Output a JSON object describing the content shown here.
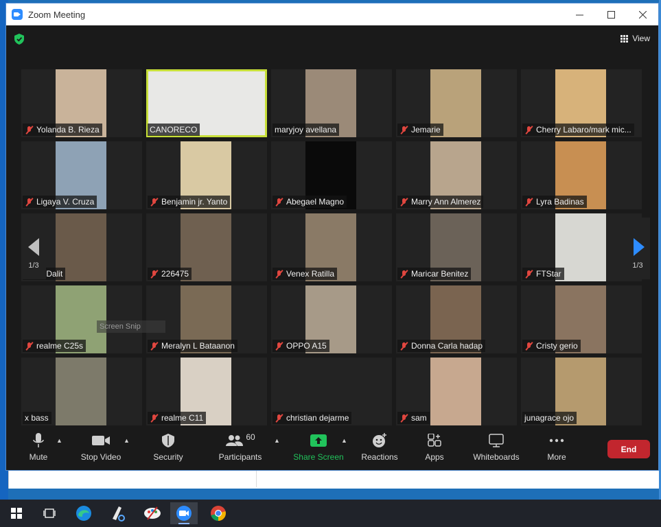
{
  "window": {
    "title": "Zoom Meeting"
  },
  "view": {
    "label": "View"
  },
  "participants": [
    {
      "name": "Yolanda B. Rieza",
      "muted": true,
      "video_color": "#c9b39a"
    },
    {
      "name": "CANORECO",
      "muted": false,
      "active_speaker": true,
      "video_color": "#e8e8e6"
    },
    {
      "name": "maryjoy avellana",
      "muted": false,
      "video_color": "#9b8a78"
    },
    {
      "name": "Jemarie",
      "muted": true,
      "video_color": "#b9a27a"
    },
    {
      "name": "Cherry Labaro/mark mic...",
      "muted": true,
      "video_color": "#d7b27a"
    },
    {
      "name": "Ligaya V. Cruza",
      "muted": true,
      "video_color": "#8ea2b5"
    },
    {
      "name": "Benjamin jr. Yanto",
      "muted": true,
      "video_color": "#d9c9a3"
    },
    {
      "name": "Abegael Magno",
      "muted": true,
      "video_color": "#0a0a0a"
    },
    {
      "name": "Marry Ann Almerez",
      "muted": true,
      "video_color": "#b8a58d"
    },
    {
      "name": "Lyra Badinas",
      "muted": true,
      "video_color": "#c88f52"
    },
    {
      "name": "an S. Dalit",
      "muted": false,
      "video_color": "#6a5a4a"
    },
    {
      "name": "226475",
      "muted": true,
      "video_color": "#6f6050"
    },
    {
      "name": "Venex Ratilla",
      "muted": true,
      "video_color": "#8a7a66"
    },
    {
      "name": "Maricar Benitez",
      "muted": true,
      "video_color": "#6b6258"
    },
    {
      "name": "FTStar",
      "muted": true,
      "video_color": "#d7d7d2"
    },
    {
      "name": "realme C25s",
      "muted": true,
      "video_color": "#8fa274"
    },
    {
      "name": "Meralyn L Bataanon",
      "muted": true,
      "video_color": "#7a6a55"
    },
    {
      "name": "OPPO A15",
      "muted": true,
      "video_color": "#a79a88"
    },
    {
      "name": "Donna Carla hadap",
      "muted": true,
      "video_color": "#7a6450"
    },
    {
      "name": "Cristy gerio",
      "muted": true,
      "video_color": "#8a7460"
    },
    {
      "name": "x bass",
      "muted": false,
      "video_color": "#7d7a6a"
    },
    {
      "name": "realme C11",
      "muted": true,
      "video_color": "#d9d0c4"
    },
    {
      "name": "christian dejarme",
      "muted": true,
      "video_color": null
    },
    {
      "name": "sam",
      "muted": true,
      "video_color": "#c7a88f"
    },
    {
      "name": "junagrace ojo",
      "muted": false,
      "video_color": "#b59a6e"
    }
  ],
  "pager": {
    "left_label": "1/3",
    "right_label": "1/3"
  },
  "overlay": {
    "snip_label": "Screen Snip"
  },
  "toolbar": {
    "mute": "Mute",
    "stop_video": "Stop Video",
    "security": "Security",
    "participants": "Participants",
    "participants_count": "60",
    "share_screen": "Share Screen",
    "reactions": "Reactions",
    "apps": "Apps",
    "whiteboards": "Whiteboards",
    "more": "More",
    "end": "End"
  },
  "colors": {
    "accent_blue": "#2d8cff",
    "share_green": "#21c35b",
    "end_red": "#c2262e",
    "speaker_highlight": "#c8e03a"
  },
  "taskbar": {
    "icons": [
      "windows-start-icon",
      "task-view-icon",
      "edge-icon",
      "snip-tool-icon",
      "paint-icon",
      "zoom-icon",
      "chrome-icon"
    ]
  }
}
